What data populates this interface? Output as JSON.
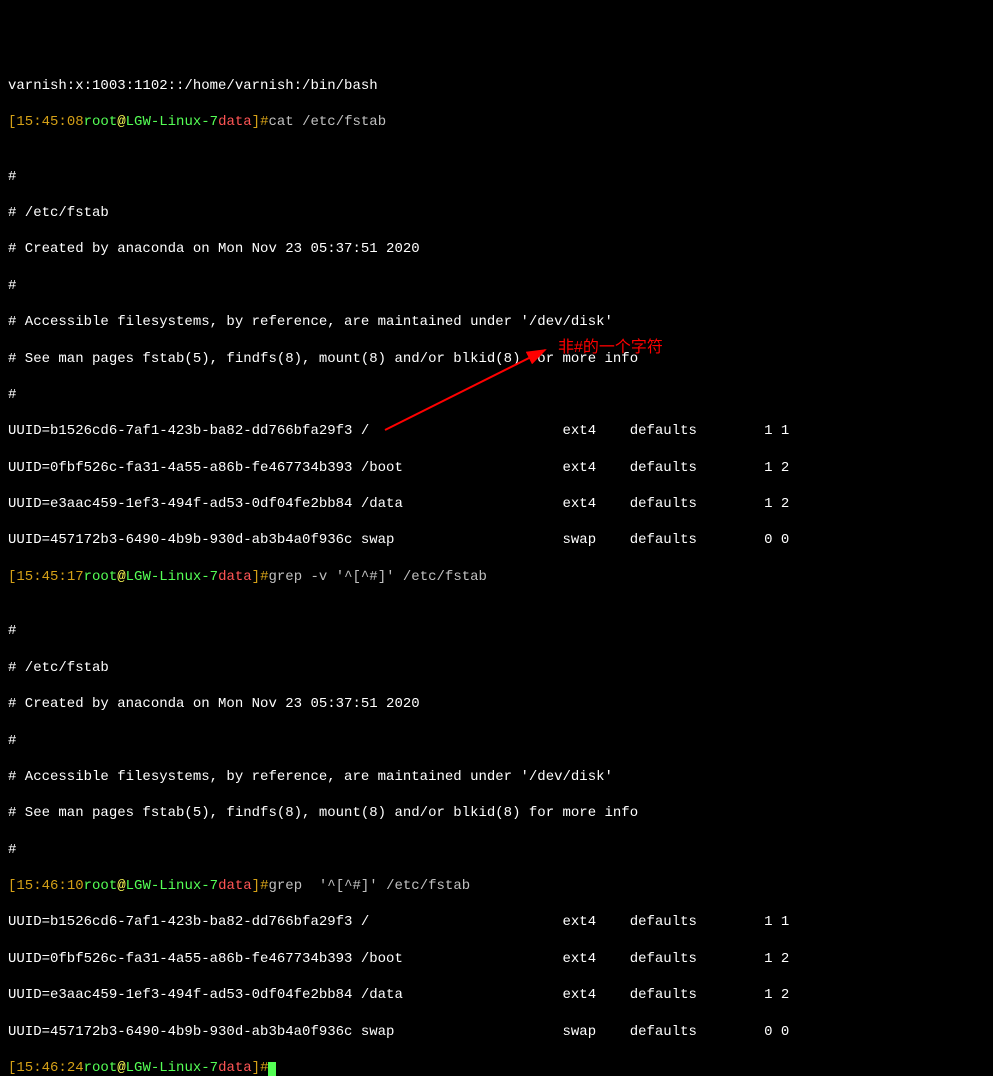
{
  "lines": {
    "header": "varnish:x:1003:1102::/home/varnish:/bin/bash",
    "prompt1": {
      "time_open": "[",
      "time": "15:45:08",
      "user": "root",
      "at": "@",
      "host": "LGW-Linux-7",
      "dir": "data",
      "close": "]#",
      "cmd": "cat /etc/fstab"
    },
    "fstab_comments": [
      "",
      "#",
      "# /etc/fstab",
      "# Created by anaconda on Mon Nov 23 05:37:51 2020",
      "#",
      "# Accessible filesystems, by reference, are maintained under '/dev/disk'",
      "# See man pages fstab(5), findfs(8), mount(8) and/or blkid(8) for more info",
      "#"
    ],
    "fstab_entries": [
      "UUID=b1526cd6-7af1-423b-ba82-dd766bfa29f3 /                       ext4    defaults        1 1",
      "UUID=0fbf526c-fa31-4a55-a86b-fe467734b393 /boot                   ext4    defaults        1 2",
      "UUID=e3aac459-1ef3-494f-ad53-0df04fe2bb84 /data                   ext4    defaults        1 2",
      "UUID=457172b3-6490-4b9b-930d-ab3b4a0f936c swap                    swap    defaults        0 0"
    ],
    "prompt2": {
      "time": "15:45:17",
      "user": "root",
      "at": "@",
      "host": "LGW-Linux-7",
      "dir": "data",
      "close": "]#",
      "cmd": "grep -v '^[^#]' /etc/fstab"
    },
    "grep_out1": [
      "",
      "#",
      "# /etc/fstab",
      "# Created by anaconda on Mon Nov 23 05:37:51 2020",
      "#",
      "# Accessible filesystems, by reference, are maintained under '/dev/disk'",
      "# See man pages fstab(5), findfs(8), mount(8) and/or blkid(8) for more info",
      "#"
    ],
    "prompt3": {
      "time": "15:46:10",
      "user": "root",
      "at": "@",
      "host": "LGW-Linux-7",
      "dir": "data",
      "close": "]#",
      "cmd": "grep  '^[^#]' /etc/fstab"
    },
    "grep_out2": [
      "UUID=b1526cd6-7af1-423b-ba82-dd766bfa29f3 /                       ext4    defaults        1 1",
      "UUID=0fbf526c-fa31-4a55-a86b-fe467734b393 /boot                   ext4    defaults        1 2",
      "UUID=e3aac459-1ef3-494f-ad53-0df04fe2bb84 /data                   ext4    defaults        1 2",
      "UUID=457172b3-6490-4b9b-930d-ab3b4a0f936c swap                    swap    defaults        0 0"
    ],
    "prompt4": {
      "time": "15:46:24",
      "user": "root",
      "at": "@",
      "host": "LGW-Linux-7",
      "dir": "data",
      "close": "]#"
    }
  },
  "annotation_text": "非#的一个字符"
}
